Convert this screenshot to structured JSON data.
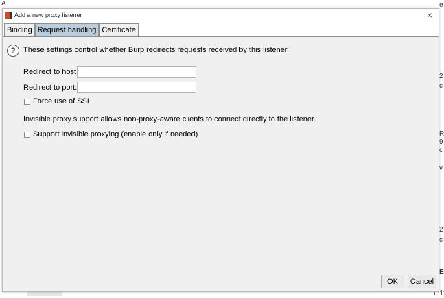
{
  "dialog": {
    "title": "Add a new proxy listener",
    "close_glyph": "×"
  },
  "tabs": [
    {
      "label": "Binding",
      "active": false
    },
    {
      "label": "Request handling",
      "active": true
    },
    {
      "label": "Certificate",
      "active": false
    }
  ],
  "content": {
    "help_glyph": "?",
    "description": "These settings control whether Burp redirects requests received by this listener.",
    "redirect_host_label": "Redirect to host:",
    "redirect_host_value": "",
    "redirect_port_label": "Redirect to port:",
    "redirect_port_value": "",
    "force_ssl_label": "Force use of SSL",
    "force_ssl_checked": false,
    "invisible_info": "Invisible proxy support allows non-proxy-aware clients to connect directly to the listener.",
    "invisible_label": "Support invisible proxying (enable only if needed)",
    "invisible_checked": false
  },
  "footer": {
    "ok_label": "OK",
    "cancel_label": "Cancel"
  },
  "colors": {
    "active_tab": "#b9cddc",
    "panel_bg": "#f0f0f0",
    "icon_accent": "#d9471f"
  }
}
